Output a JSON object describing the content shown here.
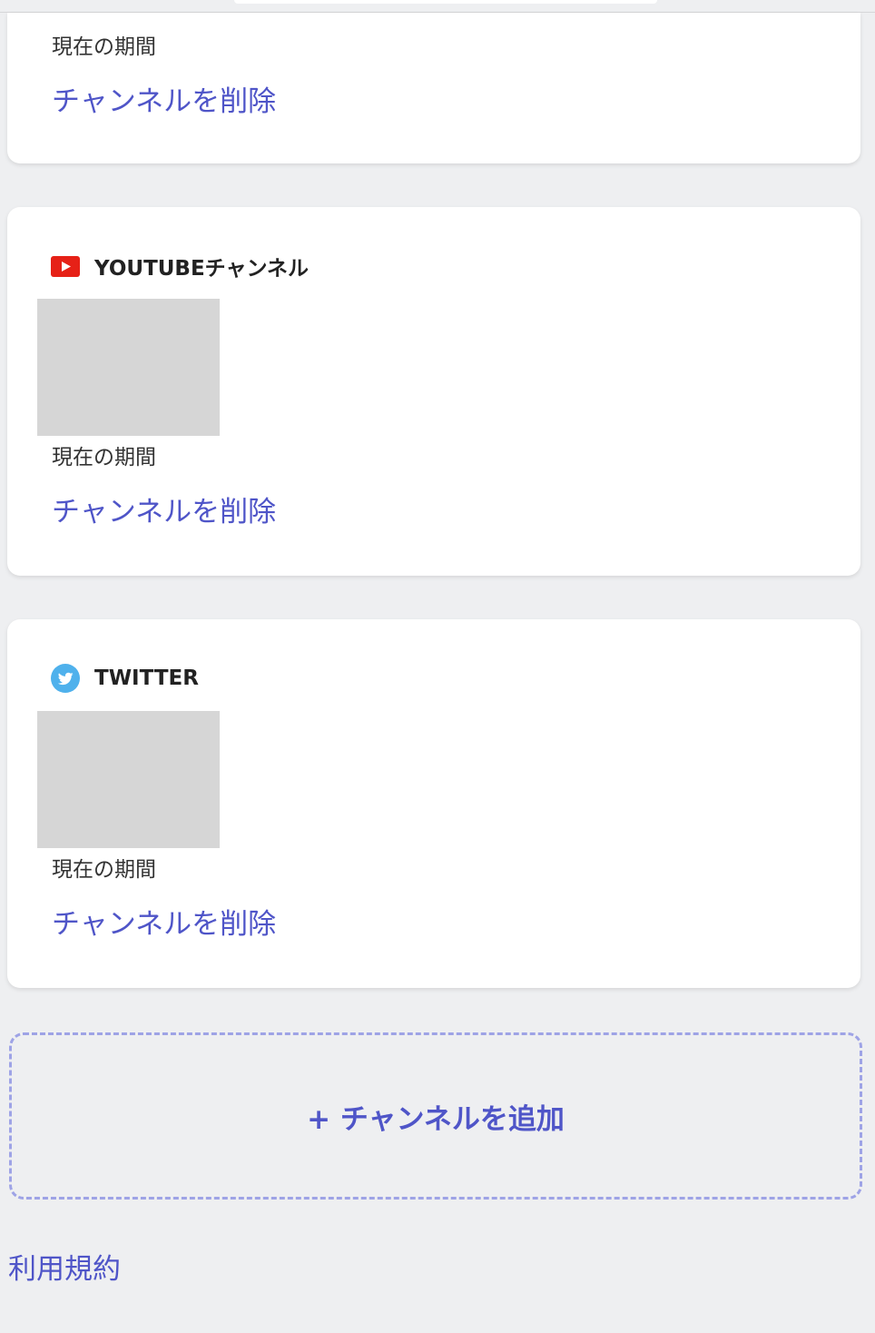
{
  "colors": {
    "accent": "#4f55c8",
    "background": "#eeeff1",
    "card": "#ffffff",
    "placeholder": "#d6d6d6",
    "youtube_red": "#e62117",
    "twitter_blue": "#4fb1ec"
  },
  "cards": [
    {
      "platform": "",
      "icon": "",
      "period_label": "現在の期間",
      "remove_label": "チャンネルを削除"
    },
    {
      "platform": "YOUTUBEチャンネル",
      "icon": "youtube-icon",
      "period_label": "現在の期間",
      "remove_label": "チャンネルを削除"
    },
    {
      "platform": "TWITTER",
      "icon": "twitter-icon",
      "period_label": "現在の期間",
      "remove_label": "チャンネルを削除"
    }
  ],
  "add_channel": {
    "label": "+ チャンネルを追加"
  },
  "footer": {
    "terms_label": "利用規約"
  }
}
